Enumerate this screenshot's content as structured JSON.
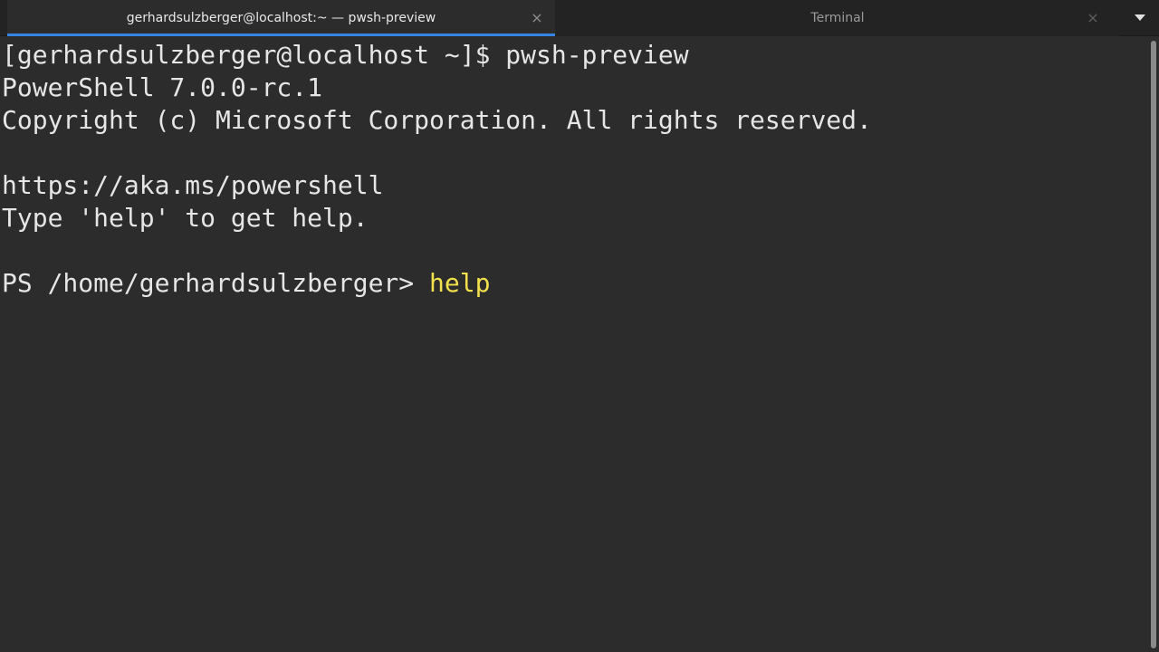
{
  "tabs": [
    {
      "title": "gerhardsulzberger@localhost:~ — pwsh-preview",
      "active": true
    },
    {
      "title": "Terminal",
      "active": false
    }
  ],
  "tab_close_glyph": "×",
  "icons": {
    "tab_close": "close-icon",
    "tab_menu": "chevron-down-icon"
  },
  "terminal": {
    "lines": [
      "[gerhardsulzberger@localhost ~]$ pwsh-preview",
      "PowerShell 7.0.0-rc.1",
      "Copyright (c) Microsoft Corporation. All rights reserved.",
      "",
      "https://aka.ms/powershell",
      "Type 'help' to get help.",
      ""
    ],
    "prompt": "PS /home/gerhardsulzberger> ",
    "command": "help"
  },
  "colors": {
    "background": "#2c2c2c",
    "foreground": "#e6e6e6",
    "command": "#f2e14d",
    "tab_accent": "#3584e4"
  }
}
